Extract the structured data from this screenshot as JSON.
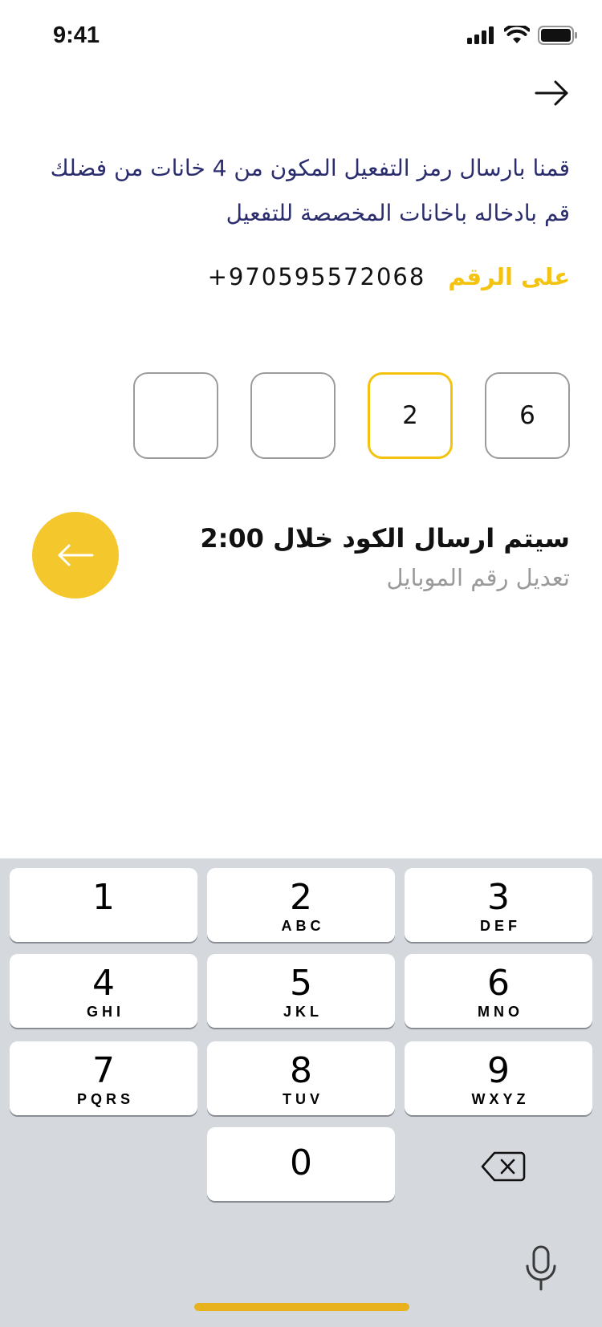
{
  "status_bar": {
    "time": "9:41",
    "icons": [
      "signal-icon",
      "wifi-icon",
      "battery-icon"
    ]
  },
  "header": {
    "back_icon": "arrow-right-icon"
  },
  "instruction": {
    "line1": "قمنا بارسال رمز التفعيل المكون من 4 خانات من فضلك",
    "line2": "قم بادخاله باخانات المخصصة للتفعيل"
  },
  "phone": {
    "label": "على الرقم",
    "number": "+970595572068"
  },
  "code": {
    "digits": [
      "6",
      "2",
      "",
      ""
    ],
    "active_index": 1
  },
  "timer": {
    "text": "سيتم ارسال الكود خلال 2:00"
  },
  "edit_phone": {
    "label": "تعديل رقم الموبايل"
  },
  "next_button": {
    "icon": "arrow-left-icon"
  },
  "keypad": {
    "keys": [
      {
        "digit": "1",
        "letters": ""
      },
      {
        "digit": "2",
        "letters": "ABC"
      },
      {
        "digit": "3",
        "letters": "DEF"
      },
      {
        "digit": "4",
        "letters": "GHI"
      },
      {
        "digit": "5",
        "letters": "JKL"
      },
      {
        "digit": "6",
        "letters": "MNO"
      },
      {
        "digit": "7",
        "letters": "PQRS"
      },
      {
        "digit": "8",
        "letters": "TUV"
      },
      {
        "digit": "9",
        "letters": "WXYZ"
      },
      {
        "digit": "0",
        "letters": ""
      }
    ],
    "icons": [
      "backspace-icon",
      "microphone-icon"
    ]
  },
  "colors": {
    "accent": "#f4c30f",
    "instruction_text": "#2b2d6e",
    "muted_text": "#9a9a9a",
    "keypad_bg": "#d5d8dd"
  }
}
